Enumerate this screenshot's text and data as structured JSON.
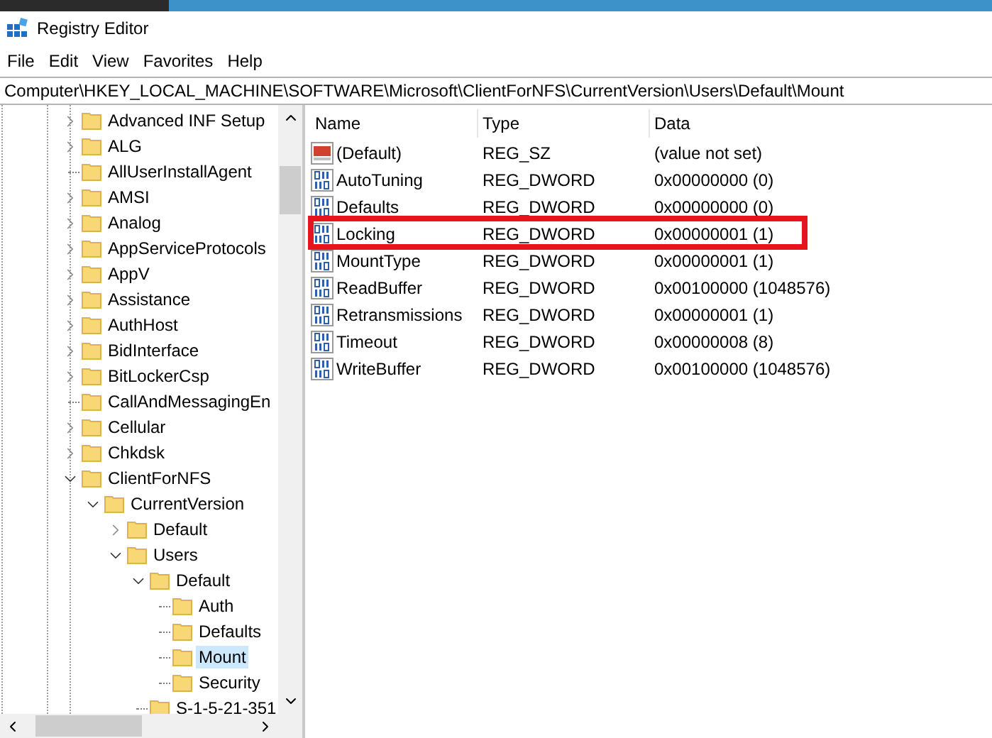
{
  "window": {
    "title": "Registry Editor"
  },
  "menu": [
    "File",
    "Edit",
    "View",
    "Favorites",
    "Help"
  ],
  "address": "Computer\\HKEY_LOCAL_MACHINE\\SOFTWARE\\Microsoft\\ClientForNFS\\CurrentVersion\\Users\\Default\\Mount",
  "tree": [
    {
      "label": "Advanced INF Setup",
      "expandable": true,
      "expanded": false,
      "selected": false
    },
    {
      "label": "ALG",
      "expandable": true,
      "expanded": false,
      "selected": false
    },
    {
      "label": "AllUserInstallAgent",
      "expandable": false,
      "selected": false
    },
    {
      "label": "AMSI",
      "expandable": true,
      "expanded": false,
      "selected": false
    },
    {
      "label": "Analog",
      "expandable": true,
      "expanded": false,
      "selected": false
    },
    {
      "label": "AppServiceProtocols",
      "expandable": true,
      "expanded": false,
      "selected": false
    },
    {
      "label": "AppV",
      "expandable": true,
      "expanded": false,
      "selected": false
    },
    {
      "label": "Assistance",
      "expandable": true,
      "expanded": false,
      "selected": false
    },
    {
      "label": "AuthHost",
      "expandable": true,
      "expanded": false,
      "selected": false
    },
    {
      "label": "BidInterface",
      "expandable": true,
      "expanded": false,
      "selected": false
    },
    {
      "label": "BitLockerCsp",
      "expandable": true,
      "expanded": false,
      "selected": false
    },
    {
      "label": "CallAndMessagingEn",
      "expandable": false,
      "selected": false
    },
    {
      "label": "Cellular",
      "expandable": true,
      "expanded": false,
      "selected": false
    },
    {
      "label": "Chkdsk",
      "expandable": true,
      "expanded": false,
      "selected": false
    },
    {
      "label": "ClientForNFS",
      "expandable": true,
      "expanded": true,
      "selected": false,
      "children": [
        {
          "label": "CurrentVersion",
          "expandable": true,
          "expanded": true,
          "selected": false,
          "children": [
            {
              "label": "Default",
              "expandable": true,
              "expanded": false,
              "selected": false
            },
            {
              "label": "Users",
              "expandable": true,
              "expanded": true,
              "selected": false,
              "children": [
                {
                  "label": "Default",
                  "expandable": true,
                  "expanded": true,
                  "selected": false,
                  "children": [
                    {
                      "label": "Auth",
                      "expandable": false,
                      "selected": false
                    },
                    {
                      "label": "Defaults",
                      "expandable": false,
                      "selected": false
                    },
                    {
                      "label": "Mount",
                      "expandable": false,
                      "selected": true
                    },
                    {
                      "label": "Security",
                      "expandable": false,
                      "selected": false
                    }
                  ]
                },
                {
                  "label": "S-1-5-21-351",
                  "expandable": false,
                  "selected": false
                }
              ]
            }
          ]
        }
      ]
    }
  ],
  "columns": [
    "Name",
    "Type",
    "Data"
  ],
  "values": [
    {
      "kind": "string",
      "name": "(Default)",
      "type": "REG_SZ",
      "data": "(value not set)",
      "highlighted": false
    },
    {
      "kind": "dword",
      "name": "AutoTuning",
      "type": "REG_DWORD",
      "data": "0x00000000 (0)",
      "highlighted": false
    },
    {
      "kind": "dword",
      "name": "Defaults",
      "type": "REG_DWORD",
      "data": "0x00000000 (0)",
      "highlighted": false
    },
    {
      "kind": "dword",
      "name": "Locking",
      "type": "REG_DWORD",
      "data": "0x00000001 (1)",
      "highlighted": true
    },
    {
      "kind": "dword",
      "name": "MountType",
      "type": "REG_DWORD",
      "data": "0x00000001 (1)",
      "highlighted": false
    },
    {
      "kind": "dword",
      "name": "ReadBuffer",
      "type": "REG_DWORD",
      "data": "0x00100000 (1048576)",
      "highlighted": false
    },
    {
      "kind": "dword",
      "name": "Retransmissions",
      "type": "REG_DWORD",
      "data": "0x00000001 (1)",
      "highlighted": false
    },
    {
      "kind": "dword",
      "name": "Timeout",
      "type": "REG_DWORD",
      "data": "0x00000008 (8)",
      "highlighted": false
    },
    {
      "kind": "dword",
      "name": "WriteBuffer",
      "type": "REG_DWORD",
      "data": "0x00100000 (1048576)",
      "highlighted": false
    }
  ]
}
